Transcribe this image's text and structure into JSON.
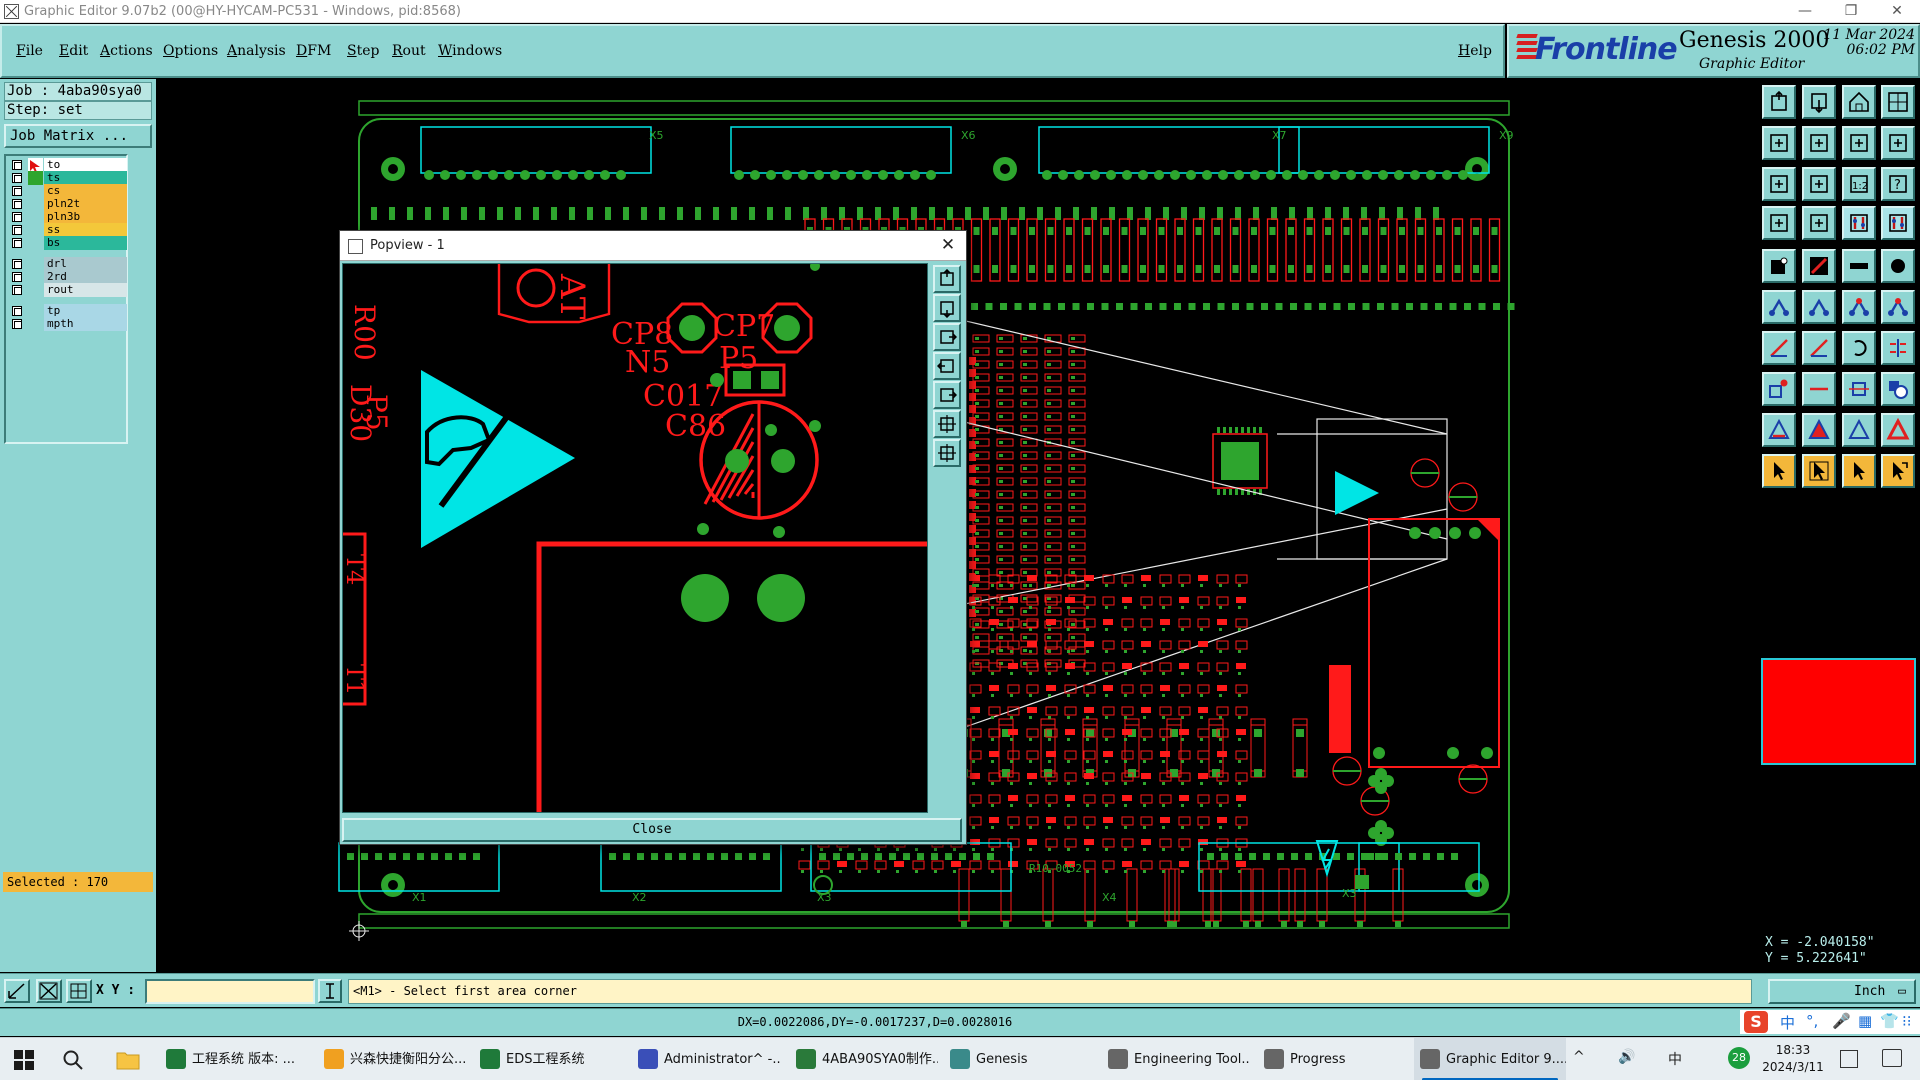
{
  "window": {
    "title": "Graphic Editor 9.07b2 (00@HY-HYCAM-PC531 - Windows, pid:8568)",
    "minimize_glyph": "—",
    "restore_glyph": "❐",
    "close_glyph": "✕"
  },
  "menu": {
    "items": [
      "File",
      "Edit",
      "Actions",
      "Options",
      "Analysis",
      "DFM",
      "Step",
      "Rout",
      "Windows"
    ],
    "help": "Help"
  },
  "brand": {
    "logo_text": "Frontline",
    "product": "Genesis 2000",
    "subtitle": "Graphic Editor",
    "date": "11 Mar 2024",
    "time": "06:02 PM"
  },
  "job": {
    "job_line": "Job : 4aba90sya0",
    "step_line": "Step: set",
    "matrix_button": "Job Matrix ..."
  },
  "layers": [
    {
      "name": "to",
      "color": "#ffffff",
      "marker": "active"
    },
    {
      "name": "ts",
      "color": "#2bb89b",
      "marker": "green"
    },
    {
      "name": "cs",
      "color": "#f3b73a",
      "marker": "none"
    },
    {
      "name": "pln2t",
      "color": "#f3b73a",
      "marker": "none"
    },
    {
      "name": "pln3b",
      "color": "#f3b73a",
      "marker": "none"
    },
    {
      "name": "ss",
      "color": "#f3c83a",
      "marker": "none"
    },
    {
      "name": "bs",
      "color": "#2bb89b",
      "marker": "none"
    },
    {
      "name": "drl",
      "color": "#a9c9cf",
      "marker": "none"
    },
    {
      "name": "2rd",
      "color": "#a9c9cf",
      "marker": "none"
    },
    {
      "name": "rout",
      "color": "#d7e6e8",
      "marker": "none"
    },
    {
      "name": "tp",
      "color": "#a9d7e6",
      "marker": "none"
    },
    {
      "name": "mpth",
      "color": "#a9d7e6",
      "marker": "none"
    }
  ],
  "selected": "Selected : 170",
  "popview": {
    "title": "Popview - 1",
    "close_button": "Close",
    "labels": [
      "CP8",
      "N5",
      "CP7",
      "P5",
      "C017",
      "C86",
      "AT",
      "R00",
      "D30",
      "P5",
      "T4",
      "T1"
    ]
  },
  "pcb_labels": [
    "X6",
    "X7",
    "X9",
    "X5",
    "X1",
    "X2",
    "X3",
    "X4",
    "X3",
    "R10-0052"
  ],
  "coords": {
    "x": "X = -2.040158\"",
    "y": "Y = 5.222641\""
  },
  "command": {
    "xy_label": "X Y :",
    "xy_value": "",
    "prompt": "<M1> - Select first area corner",
    "unit": "Inch"
  },
  "status": "DX=0.0022086,DY=-0.0017237,D=0.0028016",
  "ime": {
    "items": [
      "中",
      "°,",
      "🎤",
      "▦",
      "👕",
      "⁝⁝"
    ]
  },
  "taskbar": {
    "tasks": [
      {
        "label": "工程系统   版本: ...",
        "icon_color": "#1f7a3a"
      },
      {
        "label": "兴森快捷衡阳分公...",
        "icon_color": "#f0a020"
      },
      {
        "label": "EDS工程系统",
        "icon_color": "#1f7a3a"
      },
      {
        "label": "Administrator^ -...",
        "icon_color": "#3a4fb8"
      },
      {
        "label": "4ABA90SYA0制作...",
        "icon_color": "#2a7a3a"
      },
      {
        "label": "Genesis",
        "icon_color": "#3a8a8a"
      },
      {
        "label": "Engineering Tool...",
        "icon_color": "#666"
      },
      {
        "label": "Progress",
        "icon_color": "#666"
      },
      {
        "label": "Graphic Editor 9....",
        "icon_color": "#666",
        "active": true
      }
    ],
    "tray": [
      "^",
      "🔊",
      "中",
      "28"
    ],
    "clock_time": "18:33",
    "clock_date": "2024/3/11"
  },
  "colors": {
    "panel": "#8fd5d2",
    "pcb_green": "#2ea52e",
    "pcb_red": "#ff1a1a",
    "cyan": "#00e5e5",
    "selected_bg": "#f3b73a"
  }
}
